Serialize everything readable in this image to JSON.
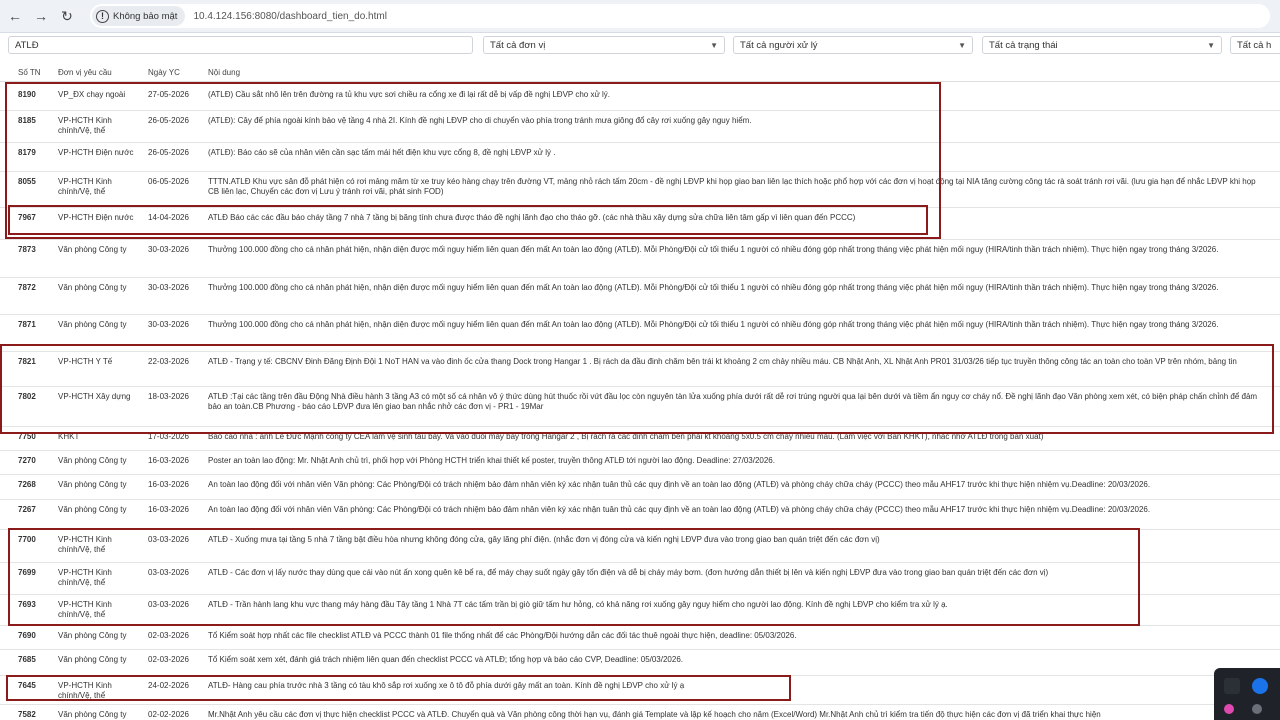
{
  "browser": {
    "back_icon": "arrow-left-icon",
    "forward_icon": "arrow-right-icon",
    "reload_icon": "reload-icon",
    "security_label": "Không bảo mật",
    "url": "10.4.124.156:8080/dashboard_tien_do.html"
  },
  "filters": {
    "search_value": "ATLĐ",
    "unit_select": "Tất cả đơn vị",
    "handler_select": "Tất cả người xử lý",
    "status_select": "Tất cả trạng thái",
    "extra_select": "Tất cả h"
  },
  "table": {
    "headers": [
      "Số TN",
      "Đơn vị yêu cầu",
      "Ngày YC",
      "Nội dung"
    ],
    "rows": [
      {
        "id": "8190",
        "unit": "VP_ĐX chạy ngoài",
        "date": "27-05-2026",
        "content": "(ATLĐ) Cầu sắt nhô lên trên đường ra tủ khu vực sơi chiều ra cổng xe đi lại rất dễ bị vấp đề nghị LĐVP cho xử lý."
      },
      {
        "id": "8185",
        "unit": "VP-HCTH Kinh chính/Vệ, thể",
        "date": "26-05-2026",
        "content": "(ATLĐ): Cây để phía ngoài kính bảo vệ tầng 4 nhà 2I. Kính đề nghị LĐVP cho di chuyển vào phía trong tránh mưa giông đổ cây rơi xuống gây nguy hiểm."
      },
      {
        "id": "8179",
        "unit": "VP-HCTH Điện nước",
        "date": "26-05-2026",
        "content": "(ATLĐ): Báo cáo sẽ của nhân viên cần sạc tấm mái hết điện khu vực cổng 8, đề nghị LĐVP xử lý ."
      },
      {
        "id": "8055",
        "unit": "VP-HCTH Kinh chính/Vệ, thể",
        "date": "06-05-2026",
        "content": "TTTN.ATLĐ Khu vực sân đỗ phát hiện có rơi mảng mâm từ xe truy kéo hàng chạy trên đường VT, mảng nhỏ rách tấm 20cm - đề nghị LĐVP khi họp giao ban liên lạc thích hoặc phổ hợp với các đơn vị hoạt động tại NIA tăng cường công tác rà soát tránh rơi vãi. (lưu gia hạn để nhắc LĐVP khi họp CB liên lạc, Chuyển các đơn vị Lưu ý tránh rơi vãi, phát sinh FOD)"
      },
      {
        "id": "7967",
        "unit": "VP-HCTH Điện nước",
        "date": "14-04-2026",
        "content": "ATLĐ Báo các các đầu báo cháy tầng 7 nhà 7 tầng bị băng tính chưa được tháo đề nghị lãnh đạo cho tháo gỡ. (các nhà thầu xây dựng sửa chữa liên tâm gấp vì liên quan đến PCCC)"
      },
      {
        "id": "7873",
        "unit": "Văn phòng Công ty",
        "date": "30-03-2026",
        "content": "Thưởng 100.000 đồng cho cá nhân phát hiện, nhận diện được mối nguy hiểm liên quan đến mất An toàn lao động (ATLĐ). Mỗi Phòng/Đội cử tối thiểu 1 người có nhiều đóng góp nhất trong tháng việc phát hiện mối nguy (HIRA/tinh thần trách nhiệm). Thực hiện ngay trong tháng 3/2026."
      },
      {
        "id": "7872",
        "unit": "Văn phòng Công ty",
        "date": "30-03-2026",
        "content": "Thưởng 100.000 đồng cho cá nhân phát hiện, nhận diện được mối nguy hiểm liên quan đến mất An toàn lao động (ATLĐ). Mỗi Phòng/Đội cử tối thiểu 1 người có nhiều đóng góp nhất trong tháng việc phát hiện mối nguy (HIRA/tinh thần trách nhiệm). Thực hiện ngay trong tháng 3/2026."
      },
      {
        "id": "7871",
        "unit": "Văn phòng Công ty",
        "date": "30-03-2026",
        "content": "Thưởng 100.000 đồng cho cá nhân phát hiện, nhận diện được mối nguy hiểm liên quan đến mất An toàn lao động (ATLĐ). Mỗi Phòng/Đội cử tối thiểu 1 người có nhiều đóng góp nhất trong tháng việc phát hiện mối nguy (HIRA/tinh thần trách nhiệm). Thực hiện ngay trong tháng 3/2026."
      },
      {
        "id": "7821",
        "unit": "VP-HCTH Y Tế",
        "date": "22-03-2026",
        "content": "ATLĐ - Trạng y tế: CBCNV Đinh Đăng Định Đội 1 NoT HAN va vào đinh ốc cửa thang Dock trong Hangar 1 . Bị rách da đầu đinh chăm bên trái kt khoảng 2 cm chảy nhiều máu. CB Nhật Anh, XL Nhật Anh PR01 31/03/26 tiếp tục truyền thông công tác an toàn cho toàn VP trên nhóm, bảng tin"
      },
      {
        "id": "7802",
        "unit": "VP-HCTH Xây dựng",
        "date": "18-03-2026",
        "content": "ATLĐ :Tại các tầng trên đầu Động Nhà điều hành 3 tầng A3 có một số cá nhân vô ý thức dùng hút thuốc rồi vứt đầu lọc còn nguyên tàn lửa xuống phía dưới rất dễ rơi trúng người qua lại bên dưới và tiềm ẩn nguy cơ cháy nổ. Đề nghị lãnh đạo Văn phòng xem xét, có biện pháp chấn chỉnh để đảm bảo an toàn.CB Phương - báo cáo LĐVP đưa lên giao ban nhắc nhở các đơn vị - PR1 - 19Mar"
      },
      {
        "id": "7750",
        "unit": "KHKT",
        "date": "17-03-2026",
        "content": "Báo cáo nhà : anh Lê Đức Mạnh công ty CEA làm vệ sinh tàu bay. Va vào đuôi máy bay trong Hangar 2 , Bị rách ra các đinh chăm bên phải kt khoảng 5x0.5 cm chảy nhiều máu. (Làm việc với Ban KHKT), nhắc nhở ATLĐ trong ban xuất)"
      },
      {
        "id": "7270",
        "unit": "Văn phòng Công ty",
        "date": "16-03-2026",
        "content": "Poster an toàn lao động: Mr. Nhật Anh chủ trì, phối hợp với Phòng HCTH triển khai thiết kế poster, truyền thông ATLĐ tới người lao động. Deadline: 27/03/2026."
      },
      {
        "id": "7268",
        "unit": "Văn phòng Công ty",
        "date": "16-03-2026",
        "content": "An toàn lao động đối với nhân viên Văn phòng: Các Phòng/Đội có trách nhiệm bảo đảm nhân viên ký xác nhận tuân thủ các quy định về an toàn lao động (ATLĐ) và phòng cháy chữa cháy (PCCC) theo mẫu AHF17 trước khi thực hiện nhiệm vụ.Deadline: 20/03/2026."
      },
      {
        "id": "7267",
        "unit": "Văn phòng Công ty",
        "date": "16-03-2026",
        "content": "An toàn lao động đối với nhân viên Văn phòng: Các Phòng/Đội có trách nhiệm bảo đảm nhân viên ký xác nhận tuân thủ các quy định về an toàn lao động (ATLĐ) và phòng cháy chữa cháy (PCCC) theo mẫu AHF17 trước khi thực hiện nhiệm vụ.Deadline: 20/03/2026."
      },
      {
        "id": "7700",
        "unit": "VP-HCTH Kinh chính/Vệ, thể",
        "date": "03-03-2026",
        "content": "ATLĐ - Xuống mưa tại tầng 5 nhà 7 tầng bật điều hòa nhưng không đóng cửa, gây lãng phí điện. (nhắc đơn vị đóng cửa và kiến nghị LĐVP đưa vào trong giao ban quán triệt đến các đơn vị)"
      },
      {
        "id": "7699",
        "unit": "VP-HCTH Kinh chính/Vệ, thể",
        "date": "03-03-2026",
        "content": "ATLĐ - Các đơn vị lấy nước thay dùng que cái vào nút ấn xong quên kê bể ra, để máy chạy suốt ngày gây tốn điện và dễ bị cháy máy bơm. (đơn hướng dẫn thiết bị lên và kiến nghị LĐVP đưa vào trong giao ban quán triệt đến các đơn vị)"
      },
      {
        "id": "7693",
        "unit": "VP-HCTH Kinh chính/Vệ, thể",
        "date": "03-03-2026",
        "content": "ATLĐ - Trần hành lang khu vực thang máy hàng đầu Tây tầng 1 Nhà 7T các tấm trần bị giò giữ tấm hư hỏng, có khả năng rơi xuống gây nguy hiểm cho người lao động. Kính đề nghị LĐVP cho kiểm tra xử lý ạ."
      },
      {
        "id": "7690",
        "unit": "Văn phòng Công ty",
        "date": "02-03-2026",
        "content": "Tổ Kiểm soát hợp nhất các file checklist ATLĐ và PCCC thành 01 file thống nhất để các Phòng/Đội hướng dẫn các đối tác thuê ngoài thực hiện, deadline: 05/03/2026."
      },
      {
        "id": "7685",
        "unit": "Văn phòng Công ty",
        "date": "02-03-2026",
        "content": "Tổ Kiểm soát xem xét, đánh giá trách nhiệm liên quan đến checklist PCCC và ATLĐ; tổng hợp và báo cáo CVP, Deadline: 05/03/2026."
      },
      {
        "id": "7645",
        "unit": "VP-HCTH Kinh chính/Vệ, thể",
        "date": "24-02-2026",
        "content": "ATLĐ- Hàng cau phía trước nhà 3 tầng có tàu khô sắp rơi xuống xe ô tô đỗ phía dưới gây mất an toàn. Kính đề nghị LĐVP cho xử lý ạ"
      },
      {
        "id": "7582",
        "unit": "Văn phòng Công ty",
        "date": "02-02-2026",
        "content": "Mr.Nhật Anh yêu cầu các đơn vị thực hiện checklist PCCC và ATLĐ. Chuyển quà và Văn phòng công thời hạn vụ, đánh giá Template và lập kế hoạch cho năm (Excel/Word) Mr.Nhật Anh chủ trì kiểm tra tiến độ thực hiện các đơn vị đã triển khai thực hiện"
      }
    ]
  },
  "taskbar": {
    "icons": [
      "app-icon",
      "browser-icon",
      "dot-icon",
      "dot-icon"
    ]
  },
  "colors": {
    "highlight": "#8b1a1a",
    "chrome_bg": "#eef1f6"
  }
}
